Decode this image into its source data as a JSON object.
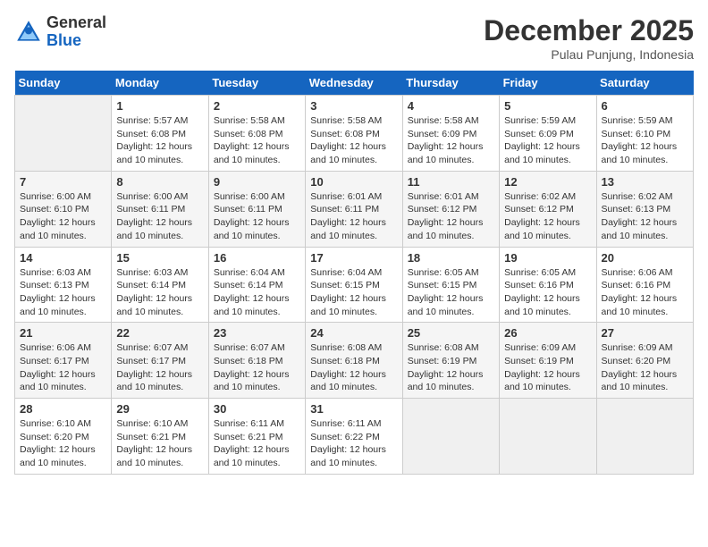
{
  "header": {
    "logo_line1": "General",
    "logo_line2": "Blue",
    "month_year": "December 2025",
    "location": "Pulau Punjung, Indonesia"
  },
  "weekdays": [
    "Sunday",
    "Monday",
    "Tuesday",
    "Wednesday",
    "Thursday",
    "Friday",
    "Saturday"
  ],
  "weeks": [
    [
      {
        "day": "",
        "sunrise": "",
        "sunset": "",
        "daylight": "",
        "empty": true
      },
      {
        "day": "1",
        "sunrise": "Sunrise: 5:57 AM",
        "sunset": "Sunset: 6:08 PM",
        "daylight": "Daylight: 12 hours and 10 minutes."
      },
      {
        "day": "2",
        "sunrise": "Sunrise: 5:58 AM",
        "sunset": "Sunset: 6:08 PM",
        "daylight": "Daylight: 12 hours and 10 minutes."
      },
      {
        "day": "3",
        "sunrise": "Sunrise: 5:58 AM",
        "sunset": "Sunset: 6:08 PM",
        "daylight": "Daylight: 12 hours and 10 minutes."
      },
      {
        "day": "4",
        "sunrise": "Sunrise: 5:58 AM",
        "sunset": "Sunset: 6:09 PM",
        "daylight": "Daylight: 12 hours and 10 minutes."
      },
      {
        "day": "5",
        "sunrise": "Sunrise: 5:59 AM",
        "sunset": "Sunset: 6:09 PM",
        "daylight": "Daylight: 12 hours and 10 minutes."
      },
      {
        "day": "6",
        "sunrise": "Sunrise: 5:59 AM",
        "sunset": "Sunset: 6:10 PM",
        "daylight": "Daylight: 12 hours and 10 minutes."
      }
    ],
    [
      {
        "day": "7",
        "sunrise": "Sunrise: 6:00 AM",
        "sunset": "Sunset: 6:10 PM",
        "daylight": "Daylight: 12 hours and 10 minutes."
      },
      {
        "day": "8",
        "sunrise": "Sunrise: 6:00 AM",
        "sunset": "Sunset: 6:11 PM",
        "daylight": "Daylight: 12 hours and 10 minutes."
      },
      {
        "day": "9",
        "sunrise": "Sunrise: 6:00 AM",
        "sunset": "Sunset: 6:11 PM",
        "daylight": "Daylight: 12 hours and 10 minutes."
      },
      {
        "day": "10",
        "sunrise": "Sunrise: 6:01 AM",
        "sunset": "Sunset: 6:11 PM",
        "daylight": "Daylight: 12 hours and 10 minutes."
      },
      {
        "day": "11",
        "sunrise": "Sunrise: 6:01 AM",
        "sunset": "Sunset: 6:12 PM",
        "daylight": "Daylight: 12 hours and 10 minutes."
      },
      {
        "day": "12",
        "sunrise": "Sunrise: 6:02 AM",
        "sunset": "Sunset: 6:12 PM",
        "daylight": "Daylight: 12 hours and 10 minutes."
      },
      {
        "day": "13",
        "sunrise": "Sunrise: 6:02 AM",
        "sunset": "Sunset: 6:13 PM",
        "daylight": "Daylight: 12 hours and 10 minutes."
      }
    ],
    [
      {
        "day": "14",
        "sunrise": "Sunrise: 6:03 AM",
        "sunset": "Sunset: 6:13 PM",
        "daylight": "Daylight: 12 hours and 10 minutes."
      },
      {
        "day": "15",
        "sunrise": "Sunrise: 6:03 AM",
        "sunset": "Sunset: 6:14 PM",
        "daylight": "Daylight: 12 hours and 10 minutes."
      },
      {
        "day": "16",
        "sunrise": "Sunrise: 6:04 AM",
        "sunset": "Sunset: 6:14 PM",
        "daylight": "Daylight: 12 hours and 10 minutes."
      },
      {
        "day": "17",
        "sunrise": "Sunrise: 6:04 AM",
        "sunset": "Sunset: 6:15 PM",
        "daylight": "Daylight: 12 hours and 10 minutes."
      },
      {
        "day": "18",
        "sunrise": "Sunrise: 6:05 AM",
        "sunset": "Sunset: 6:15 PM",
        "daylight": "Daylight: 12 hours and 10 minutes."
      },
      {
        "day": "19",
        "sunrise": "Sunrise: 6:05 AM",
        "sunset": "Sunset: 6:16 PM",
        "daylight": "Daylight: 12 hours and 10 minutes."
      },
      {
        "day": "20",
        "sunrise": "Sunrise: 6:06 AM",
        "sunset": "Sunset: 6:16 PM",
        "daylight": "Daylight: 12 hours and 10 minutes."
      }
    ],
    [
      {
        "day": "21",
        "sunrise": "Sunrise: 6:06 AM",
        "sunset": "Sunset: 6:17 PM",
        "daylight": "Daylight: 12 hours and 10 minutes."
      },
      {
        "day": "22",
        "sunrise": "Sunrise: 6:07 AM",
        "sunset": "Sunset: 6:17 PM",
        "daylight": "Daylight: 12 hours and 10 minutes."
      },
      {
        "day": "23",
        "sunrise": "Sunrise: 6:07 AM",
        "sunset": "Sunset: 6:18 PM",
        "daylight": "Daylight: 12 hours and 10 minutes."
      },
      {
        "day": "24",
        "sunrise": "Sunrise: 6:08 AM",
        "sunset": "Sunset: 6:18 PM",
        "daylight": "Daylight: 12 hours and 10 minutes."
      },
      {
        "day": "25",
        "sunrise": "Sunrise: 6:08 AM",
        "sunset": "Sunset: 6:19 PM",
        "daylight": "Daylight: 12 hours and 10 minutes."
      },
      {
        "day": "26",
        "sunrise": "Sunrise: 6:09 AM",
        "sunset": "Sunset: 6:19 PM",
        "daylight": "Daylight: 12 hours and 10 minutes."
      },
      {
        "day": "27",
        "sunrise": "Sunrise: 6:09 AM",
        "sunset": "Sunset: 6:20 PM",
        "daylight": "Daylight: 12 hours and 10 minutes."
      }
    ],
    [
      {
        "day": "28",
        "sunrise": "Sunrise: 6:10 AM",
        "sunset": "Sunset: 6:20 PM",
        "daylight": "Daylight: 12 hours and 10 minutes."
      },
      {
        "day": "29",
        "sunrise": "Sunrise: 6:10 AM",
        "sunset": "Sunset: 6:21 PM",
        "daylight": "Daylight: 12 hours and 10 minutes."
      },
      {
        "day": "30",
        "sunrise": "Sunrise: 6:11 AM",
        "sunset": "Sunset: 6:21 PM",
        "daylight": "Daylight: 12 hours and 10 minutes."
      },
      {
        "day": "31",
        "sunrise": "Sunrise: 6:11 AM",
        "sunset": "Sunset: 6:22 PM",
        "daylight": "Daylight: 12 hours and 10 minutes."
      },
      {
        "day": "",
        "sunrise": "",
        "sunset": "",
        "daylight": "",
        "empty": true
      },
      {
        "day": "",
        "sunrise": "",
        "sunset": "",
        "daylight": "",
        "empty": true
      },
      {
        "day": "",
        "sunrise": "",
        "sunset": "",
        "daylight": "",
        "empty": true
      }
    ]
  ]
}
